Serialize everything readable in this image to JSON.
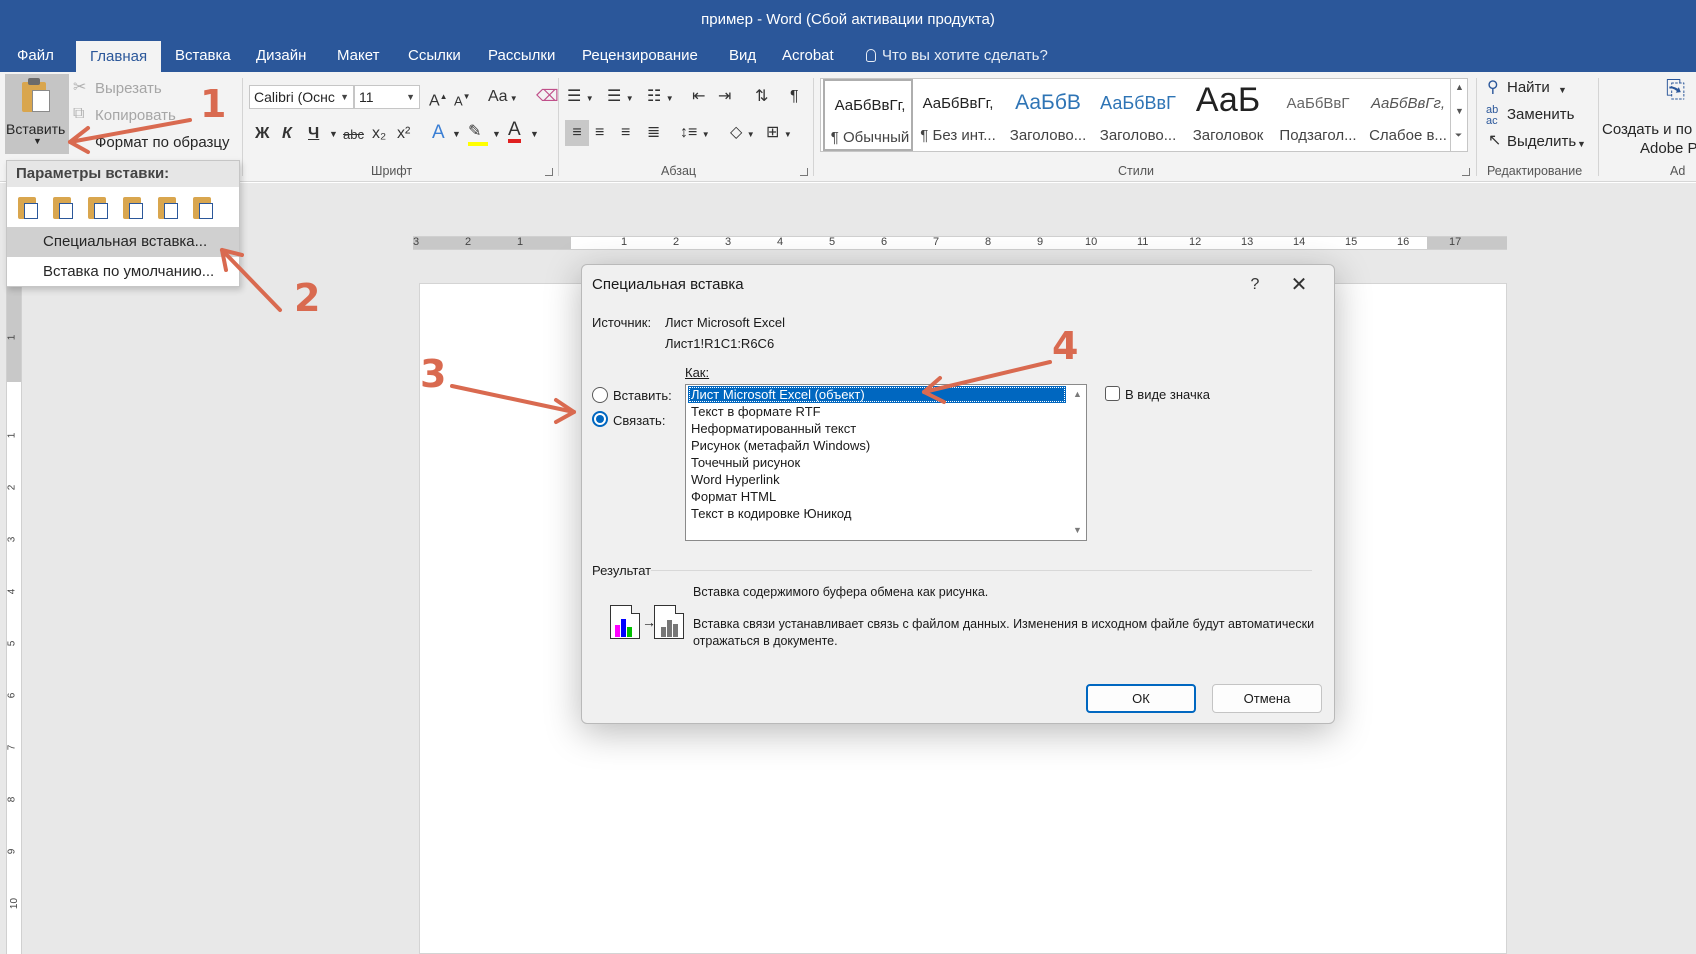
{
  "window": {
    "title": "пример - Word (Сбой активации продукта)"
  },
  "tabs": [
    "Файл",
    "Главная",
    "Вставка",
    "Дизайн",
    "Макет",
    "Ссылки",
    "Рассылки",
    "Рецензирование",
    "Вид",
    "Acrobat"
  ],
  "tell_me": "Что вы хотите сделать?",
  "ribbon": {
    "clipboard": {
      "paste": "Вставить",
      "cut": "Вырезать",
      "copy": "Копировать",
      "format_painter": "Формат по образцу"
    },
    "font": {
      "name": "Calibri (Оснс",
      "size": "11",
      "group_label": "Шрифт",
      "change_case": "Aa",
      "bold": "Ж",
      "italic": "К",
      "underline": "Ч",
      "strike": "abc",
      "sub": "x₂",
      "sup": "x²",
      "font_color_letter": "A",
      "grow": "A",
      "shrink": "A",
      "effects": "A"
    },
    "paragraph": {
      "group_label": "Абзац",
      "pilcrow": "¶"
    },
    "styles": {
      "group_label": "Стили",
      "items": [
        {
          "preview": "АаБбВвГг,",
          "name": "¶ Обычный"
        },
        {
          "preview": "АаБбВвГг,",
          "name": "¶ Без инт..."
        },
        {
          "preview": "АаБбВ",
          "name": "Заголово..."
        },
        {
          "preview": "АаБбВвГ",
          "name": "Заголово..."
        },
        {
          "preview": "АаБ",
          "name": "Заголовок"
        },
        {
          "preview": "АаБбВвГ",
          "name": "Подзагол..."
        },
        {
          "preview": "АаБбВвГг,",
          "name": "Слабое в..."
        }
      ]
    },
    "editing": {
      "find": "Найти",
      "replace": "Заменить",
      "select": "Выделить",
      "group_label": "Редактирование"
    },
    "adobe": {
      "line1": "Создать и по",
      "line2": "Adobe P",
      "group_label": "Ad"
    }
  },
  "paste_menu": {
    "header": "Параметры вставки:",
    "items": [
      "Специальная вставка...",
      "Вставка по умолчанию..."
    ]
  },
  "ruler": {
    "h": [
      "3",
      "2",
      "1",
      "1",
      "2",
      "3",
      "4",
      "5",
      "6",
      "7",
      "8",
      "9",
      "10",
      "11",
      "12",
      "13",
      "14",
      "15",
      "16",
      "17"
    ],
    "v": [
      "1",
      "1",
      "2",
      "3",
      "4",
      "5",
      "6",
      "7",
      "8",
      "9",
      "10"
    ]
  },
  "dialog": {
    "title": "Специальная вставка",
    "help": "?",
    "source_label": "Источник:",
    "source_value": "Лист Microsoft Excel",
    "source_range": "Лист1!R1C1:R6C6",
    "as_label": "Как:",
    "radio_paste": "Вставить:",
    "radio_link": "Связать:",
    "list": [
      "Лист Microsoft Excel (объект)",
      "Текст в формате RTF",
      "Неформатированный текст",
      "Рисунок (метафайл Windows)",
      "Точечный рисунок",
      "Word Hyperlink",
      "Формат HTML",
      "Текст в кодировке Юникод"
    ],
    "as_icon": "В виде значка",
    "result_label": "Результат",
    "result_line1": "Вставка содержимого буфера обмена как рисунка.",
    "result_line2": "Вставка связи устанавливает связь с файлом данных. Изменения в исходном файле будут автоматически",
    "result_line3": "отражаться в документе.",
    "ok": "ОК",
    "cancel": "Отмена"
  },
  "annotations": [
    "1",
    "2",
    "3",
    "4"
  ],
  "colors": {
    "word_blue": "#2b579a",
    "accent": "#0067c0",
    "annotation": "#d96a50"
  }
}
